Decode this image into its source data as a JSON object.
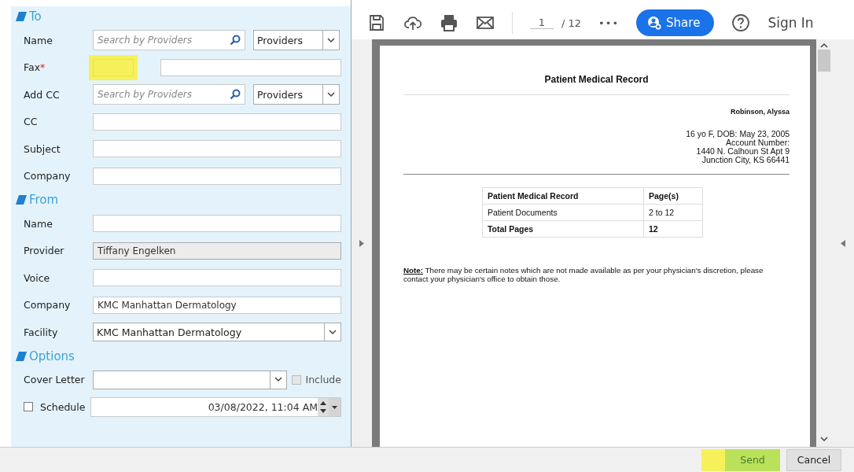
{
  "form": {
    "sections": [
      {
        "heading": "To",
        "fields": [
          {
            "kind": "search",
            "label": "Name",
            "placeholder": "Search by Providers",
            "select": "Providers"
          },
          {
            "kind": "fax",
            "label": "Fax",
            "required_mark": "*",
            "highlighted": true
          },
          {
            "kind": "search",
            "label": "Add CC",
            "placeholder": "Search by Providers",
            "select": "Providers"
          },
          {
            "kind": "text",
            "label": "CC"
          },
          {
            "kind": "text",
            "label": "Subject"
          },
          {
            "kind": "text",
            "label": "Company"
          }
        ]
      },
      {
        "heading": "From",
        "fields": [
          {
            "kind": "text",
            "label": "Name"
          },
          {
            "kind": "text",
            "label": "Provider",
            "value": "Tiffany Engelken",
            "disabled": true
          },
          {
            "kind": "text",
            "label": "Voice"
          },
          {
            "kind": "text",
            "label": "Company",
            "value": "KMC Manhattan Dermatology",
            "disabled": false
          },
          {
            "kind": "select",
            "label": "Facility",
            "value": "KMC Manhattan Dermatology"
          }
        ]
      },
      {
        "heading": "Options",
        "fields": [
          {
            "kind": "cover",
            "label": "Cover Letter",
            "checkbox_label": "Include",
            "checked": false,
            "disabled": true
          },
          {
            "kind": "schedule",
            "label": "Schedule",
            "checked": false,
            "value": "03/08/2022, 11:04 AM"
          }
        ]
      }
    ]
  },
  "viewer": {
    "toolbar": {
      "page": "1",
      "total": "/ 12",
      "more": "•••",
      "share": "Share",
      "sign_in": "Sign In"
    },
    "document": {
      "title": "Patient Medical Record",
      "patient": "Robinson, Alyssa",
      "address": [
        "16 yo F, DOB: May 23, 2005",
        "Account Number:",
        "1440 N. Calhoun St Apt 9",
        "Junction City, KS 66441"
      ],
      "table": {
        "columns": [
          "Patient Medical Record",
          "Page(s)"
        ],
        "rows": [
          {
            "cells": [
              "Patient Documents",
              "2 to 12"
            ],
            "bold": false
          },
          {
            "cells": [
              "Total Pages",
              "12"
            ],
            "bold": true
          }
        ]
      },
      "note": "**Note:** There may be certain notes which are not made available as per your physician's discretion, please contact your physician's office to obtain those."
    }
  },
  "footer": {
    "buttons": [
      {
        "label": "Send",
        "highlighted": true
      },
      {
        "label": "Cancel",
        "highlighted": false
      }
    ]
  }
}
